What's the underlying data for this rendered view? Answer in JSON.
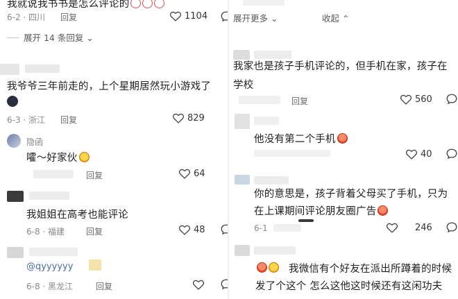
{
  "left": {
    "top_comment": {
      "text": "我就说我书书是怎么评论的",
      "meta": "6-2 · 四川",
      "reply": "回复",
      "likes": "1104",
      "expand": "展开 14 条回复"
    },
    "comment_1": {
      "text": "我爷爷三年前走的，上个星期居然玩小游戏了",
      "meta": "6-3 · 浙江",
      "reply": "回复",
      "likes": "829"
    },
    "comment_2": {
      "user": "隐函",
      "text": "嚯～好家伙",
      "reply": "回复",
      "likes": "64"
    },
    "comment_3": {
      "text": "我姐姐在高考也能评论",
      "meta": "6-8 · 福建",
      "reply": "回复",
      "likes": "48"
    },
    "comment_4": {
      "text": "@qyyyyyy",
      "meta": "6-8 · 黑龙江",
      "reply": "回复"
    }
  },
  "right": {
    "top_row": {
      "expand": "展开更多",
      "collapse": "收起"
    },
    "comment_1": {
      "text_line1": "我家也是孩子手机评论的，但手机在家，孩子在",
      "text_line2": "学校",
      "reply": "回复",
      "likes": "560"
    },
    "comment_2": {
      "text": "他没有第二个手机",
      "likes": "40"
    },
    "comment_3": {
      "text_line1": "你的意思是，孩子背着父母买了手机，只为",
      "text_line2": "在上课期间评论朋友圈广告",
      "meta": "6-1",
      "likes": "246"
    },
    "comment_4": {
      "text_line1": "我微信有个好友在派出所蹲着的时候",
      "text_line2": "发了个这个 怎么这他这时候还有这闲功夫"
    }
  }
}
